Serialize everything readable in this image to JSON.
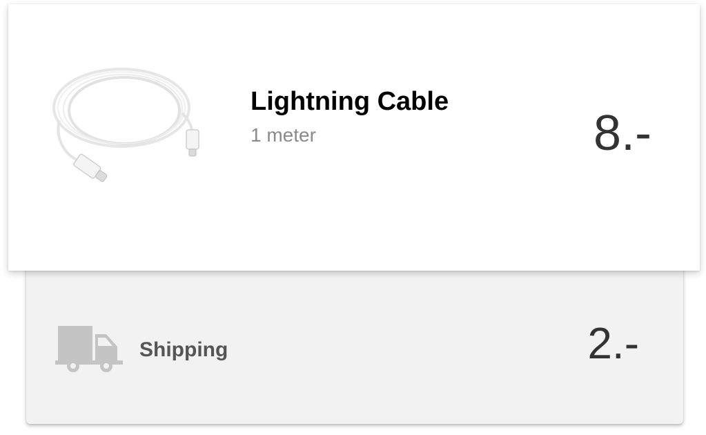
{
  "product": {
    "image_icon": "lightning-cable-image",
    "name": "Lightning Cable",
    "variant": "1 meter",
    "price": "8.-"
  },
  "shipping": {
    "icon": "truck-icon",
    "label": "Shipping",
    "price": "2.-"
  },
  "colors": {
    "card_bg": "#ffffff",
    "shipping_bg": "#f2f2f2",
    "truck": "#c4c4c4",
    "price_text": "#333333",
    "muted_text": "#8a8a8a"
  }
}
